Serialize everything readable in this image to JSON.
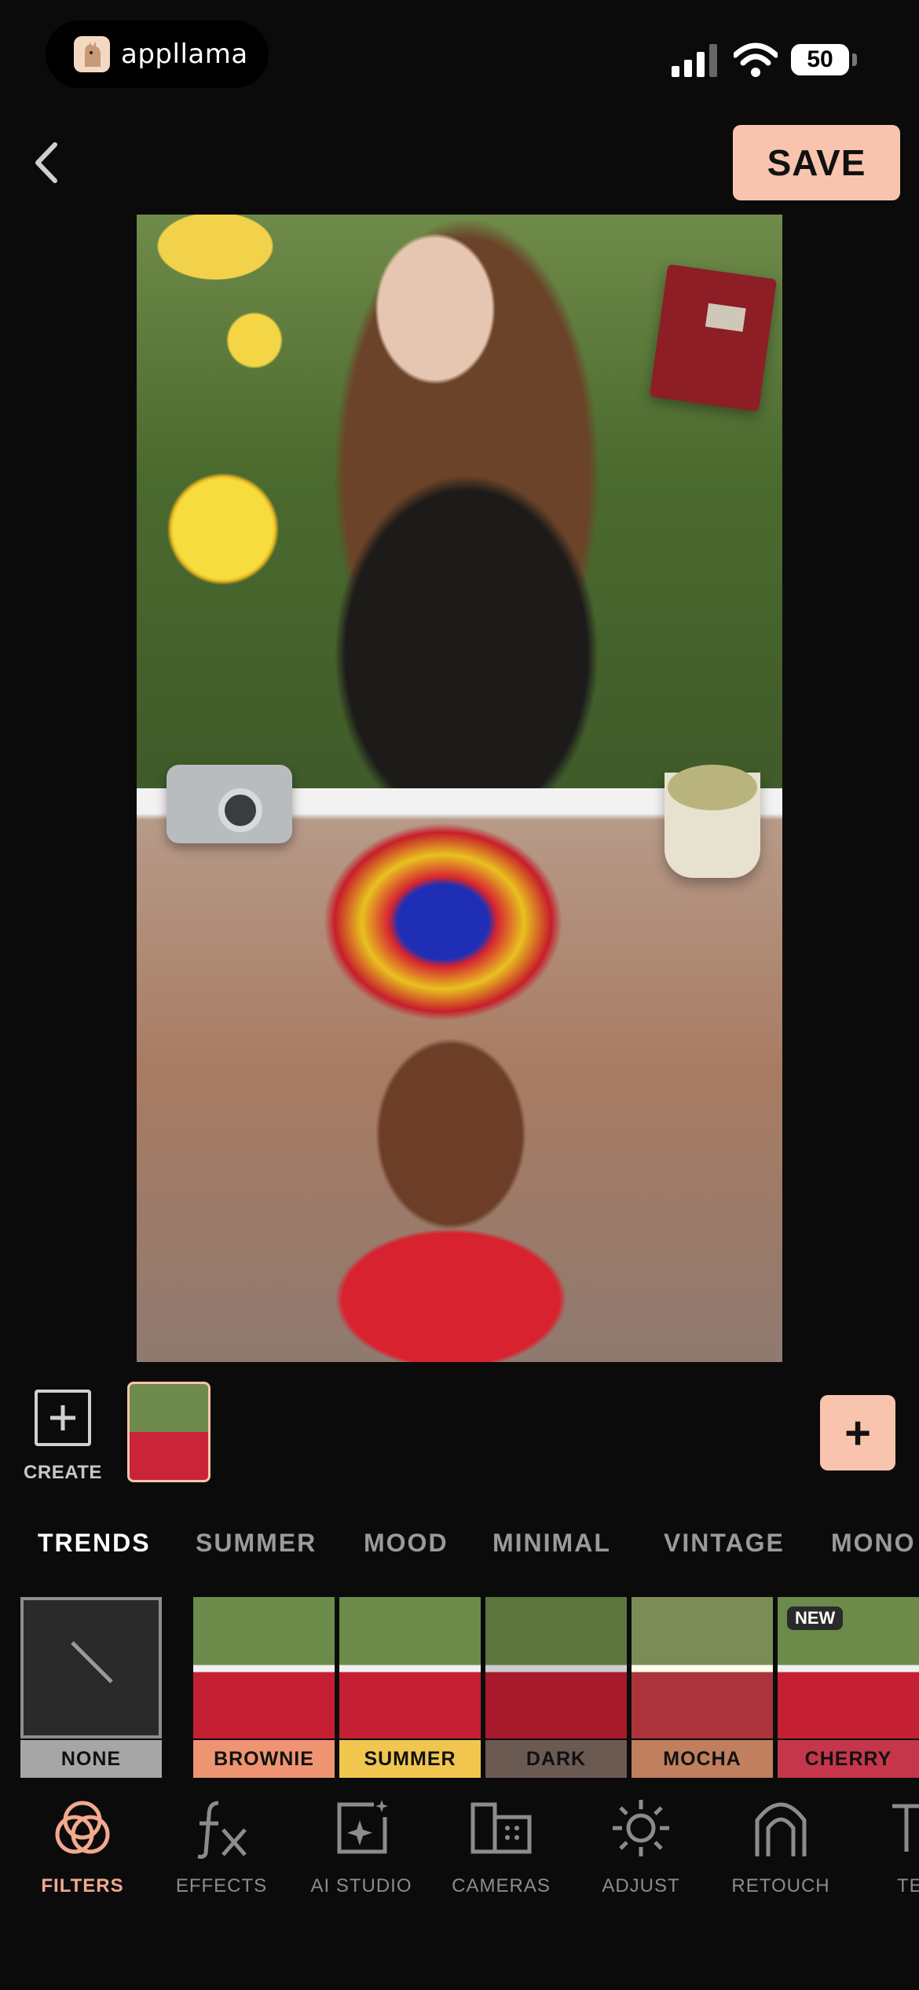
{
  "status_bar": {
    "brand": "appllama",
    "battery": "50"
  },
  "header": {
    "save_label": "SAVE"
  },
  "slides": {
    "create_label": "CREATE",
    "add_label": "+"
  },
  "category_tabs": [
    {
      "label": "TRENDS",
      "active": true
    },
    {
      "label": "SUMMER",
      "active": false
    },
    {
      "label": "MOOD",
      "active": false
    },
    {
      "label": "MINIMAL",
      "active": false
    },
    {
      "label": "VINTAGE",
      "active": false
    },
    {
      "label": "MONO",
      "active": false
    }
  ],
  "filters": [
    {
      "label": "NONE",
      "color": "#a6a6a6",
      "selected": true
    },
    {
      "label": "BROWNIE",
      "color": "#ef9472"
    },
    {
      "label": "SUMMER",
      "color": "#f0c64e"
    },
    {
      "label": "DARK",
      "color": "#6b5a52"
    },
    {
      "label": "MOCHA",
      "color": "#c07f5e"
    },
    {
      "label": "CHERRY",
      "color": "#c5364a",
      "badge": "NEW"
    }
  ],
  "bottom_nav": [
    {
      "label": "FILTERS",
      "icon": "rings-icon",
      "active": true
    },
    {
      "label": "EFFECTS",
      "icon": "fx-icon",
      "active": false
    },
    {
      "label": "AI STUDIO",
      "icon": "ai-sparkle-icon",
      "active": false
    },
    {
      "label": "CAMERAS",
      "icon": "camera-film-icon",
      "active": false
    },
    {
      "label": "ADJUST",
      "icon": "sun-adjust-icon",
      "active": false
    },
    {
      "label": "RETOUCH",
      "icon": "retouch-icon",
      "active": false
    },
    {
      "label": "TE",
      "icon": "text-icon",
      "active": false
    }
  ],
  "colors": {
    "accent": "#f9c4ad",
    "accent_text": "#f2a98e",
    "background": "#0b0b0c"
  }
}
